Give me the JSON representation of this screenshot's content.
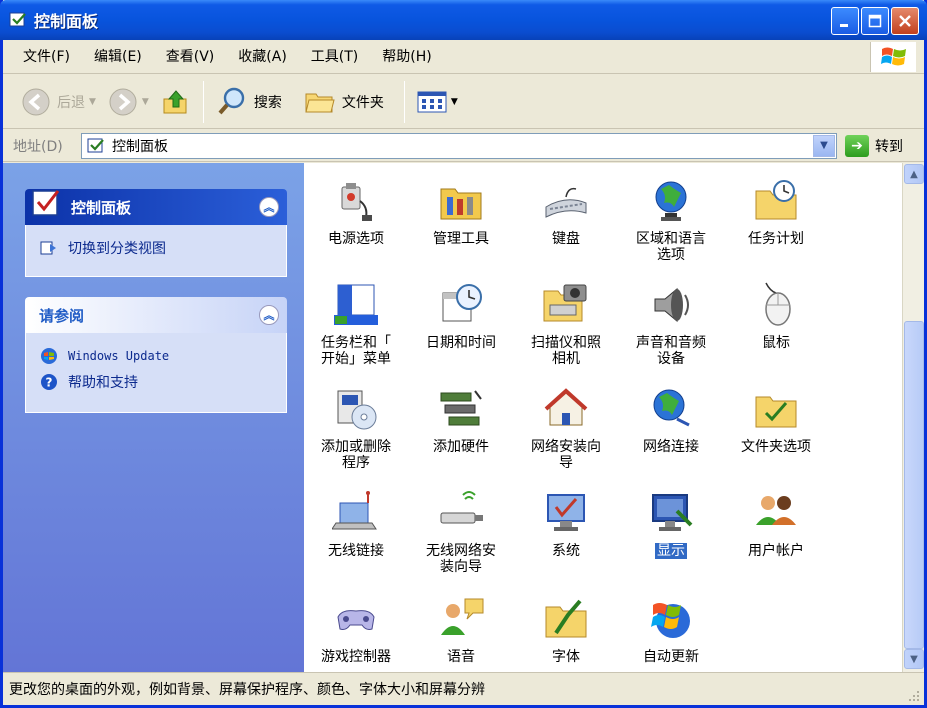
{
  "window": {
    "title": "控制面板"
  },
  "menu": [
    "文件(F)",
    "编辑(E)",
    "查看(V)",
    "收藏(A)",
    "工具(T)",
    "帮助(H)"
  ],
  "toolbar": {
    "back": "后退",
    "search": "搜索",
    "folders": "文件夹"
  },
  "address": {
    "label": "地址(D)",
    "value": "控制面板",
    "go": "转到"
  },
  "sidebar": {
    "control_panel": {
      "title": "控制面板",
      "link": "切换到分类视图"
    },
    "see_also": {
      "title": "请参阅",
      "links": [
        "Windows Update",
        "帮助和支持"
      ]
    }
  },
  "items": [
    {
      "line1": "电源选项",
      "line2": ""
    },
    {
      "line1": "管理工具",
      "line2": ""
    },
    {
      "line1": "键盘",
      "line2": ""
    },
    {
      "line1": "区域和语言",
      "line2": "选项"
    },
    {
      "line1": "任务计划",
      "line2": ""
    },
    {
      "line1": "任务栏和「",
      "line2": "开始」菜单"
    },
    {
      "line1": "日期和时间",
      "line2": ""
    },
    {
      "line1": "扫描仪和照",
      "line2": "相机"
    },
    {
      "line1": "声音和音频",
      "line2": "设备"
    },
    {
      "line1": "鼠标",
      "line2": ""
    },
    {
      "line1": "添加或删除",
      "line2": "程序"
    },
    {
      "line1": "添加硬件",
      "line2": ""
    },
    {
      "line1": "网络安装向",
      "line2": "导"
    },
    {
      "line1": "网络连接",
      "line2": ""
    },
    {
      "line1": "文件夹选项",
      "line2": ""
    },
    {
      "line1": "无线链接",
      "line2": ""
    },
    {
      "line1": "无线网络安",
      "line2": "装向导"
    },
    {
      "line1": "系统",
      "line2": ""
    },
    {
      "line1": "显示",
      "line2": ""
    },
    {
      "line1": "用户帐户",
      "line2": ""
    },
    {
      "line1": "游戏控制器",
      "line2": ""
    },
    {
      "line1": "语音",
      "line2": ""
    },
    {
      "line1": "字体",
      "line2": ""
    },
    {
      "line1": "自动更新",
      "line2": ""
    }
  ],
  "status": "更改您的桌面的外观，例如背景、屏幕保护程序、颜色、字体大小和屏幕分辨"
}
